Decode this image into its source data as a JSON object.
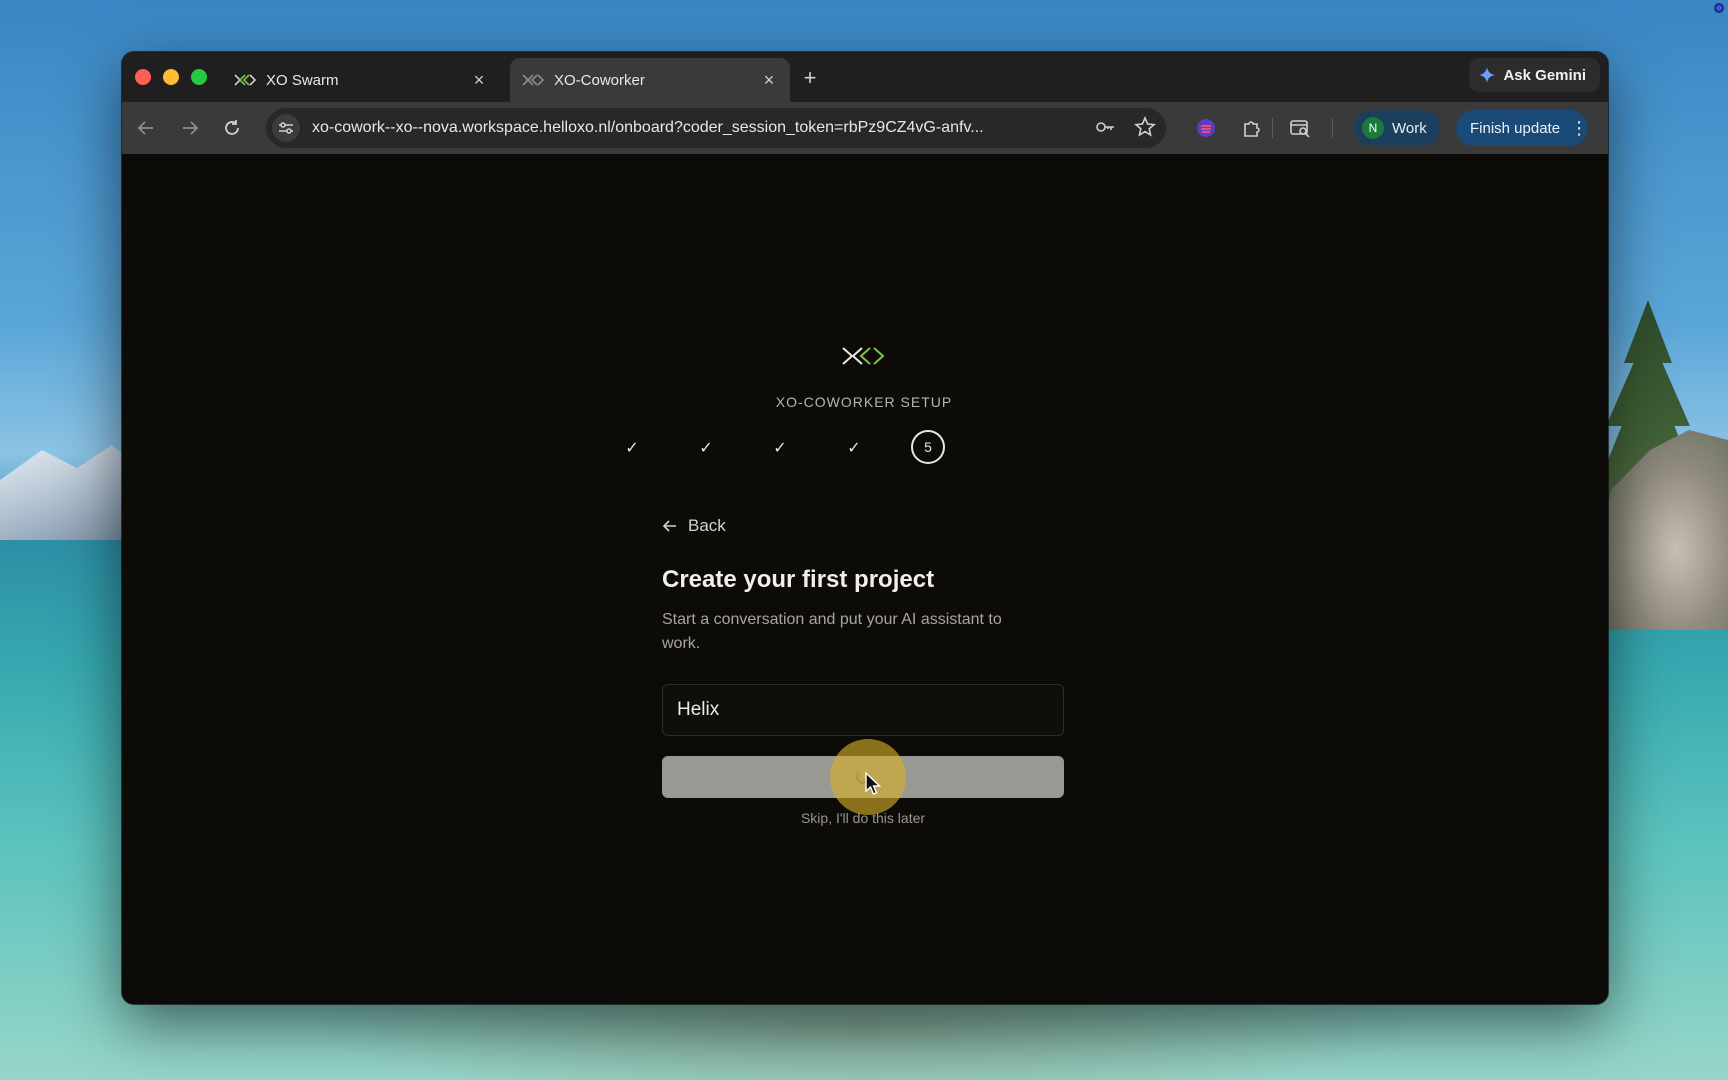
{
  "browser": {
    "tabs": [
      {
        "title": "XO Swarm",
        "active": false
      },
      {
        "title": "XO-Coworker",
        "active": true
      }
    ],
    "new_tab_symbol": "+",
    "ask_gemini_label": "Ask Gemini",
    "url": "xo-cowork--xo--nova.workspace.helloxo.nl/onboard?coder_session_token=rbPz9CZ4vG-anfv...",
    "profile": {
      "initial": "N",
      "label": "Work"
    },
    "finish_update_label": "Finish update",
    "icons": [
      "back-arrow-icon",
      "forward-arrow-icon",
      "reload-icon",
      "site-settings-icon",
      "password-key-icon",
      "bookmark-star-icon",
      "extension-icon",
      "puzzle-icon",
      "tab-search-icon",
      "kebab-menu-icon"
    ],
    "colors": {
      "tabbar": "#1f1f1f",
      "toolbar": "#3a3a3a",
      "omnibox": "#282828",
      "work_chip": "#1d3f5e",
      "finish_chip": "#1a4a78"
    }
  },
  "page": {
    "setup_title": "XO-COWORKER SETUP",
    "steps": {
      "completed": [
        "✓",
        "✓",
        "✓",
        "✓"
      ],
      "current": "5"
    },
    "back_label": "Back",
    "heading": "Create your first project",
    "subtitle": "Start a conversation and put your AI assistant to work.",
    "project_name_value": "Helix",
    "create_button_state": "loading",
    "skip_label": "Skip, I'll do this later",
    "colors": {
      "background": "#0c0b08",
      "accent": "#7fc24a",
      "button": "#9a9892",
      "click_halo": "#d6b028"
    }
  }
}
